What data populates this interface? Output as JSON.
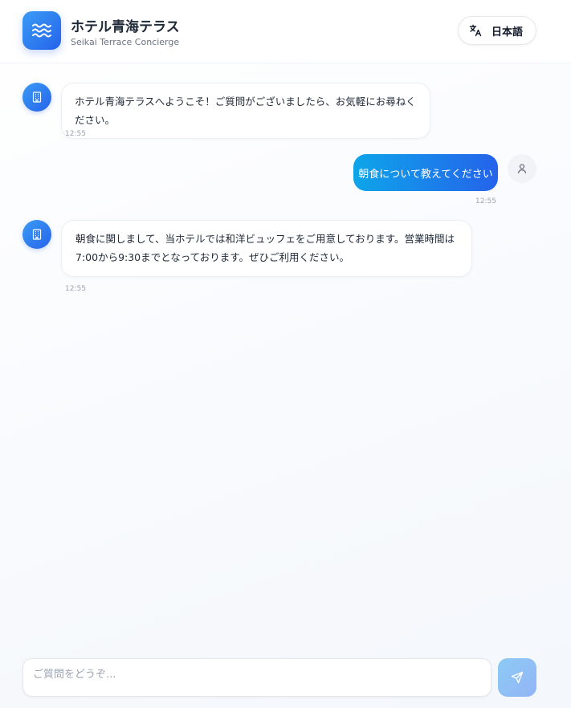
{
  "header": {
    "title": "ホテル青海テラス",
    "subtitle": "Seikai Terrace Concierge",
    "language_label": "日本語"
  },
  "messages": [
    {
      "role": "bot",
      "text": "ホテル青海テラスへようこそ！ご質問がございましたら、お気軽にお尋ねください。",
      "time": "12:55"
    },
    {
      "role": "user",
      "text": "朝食について教えてください",
      "time": "12:55"
    },
    {
      "role": "bot",
      "text": "朝食に関しまして、当ホテルでは和洋ビュッフェをご用意しております。営業時間は7:00から9:30までとなっております。ぜひご利用ください。",
      "time": "12:55"
    }
  ],
  "composer": {
    "placeholder": "ご質問をどうぞ..."
  },
  "icons": {
    "logo": "waves-icon",
    "language": "translate-icon",
    "bot_avatar": "building-icon",
    "user_avatar": "user-icon",
    "send": "send-icon"
  },
  "colors": {
    "accent": "#2563eb",
    "accent_light": "#0ea5e9"
  }
}
